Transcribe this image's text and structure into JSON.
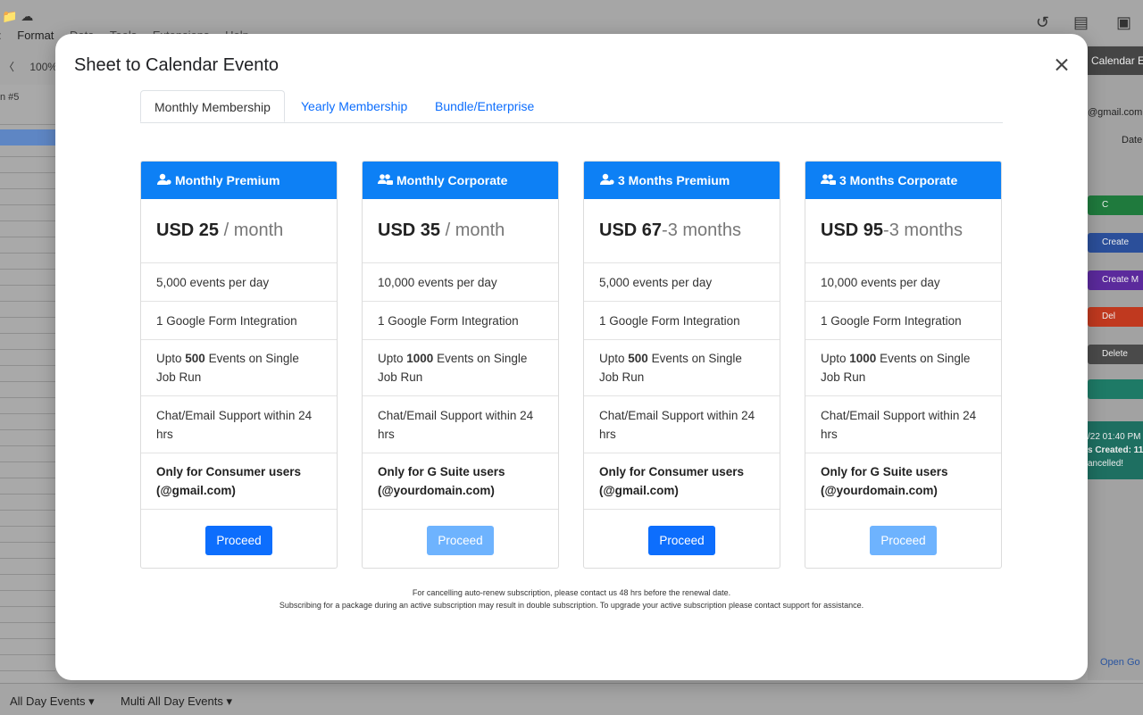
{
  "background": {
    "menu": [
      "Format",
      "Data",
      "Tools",
      "Extensions",
      "Help"
    ],
    "zoom": "100%",
    "name_box": "n #5",
    "sidebar": {
      "title": "Calendar Ev",
      "email": "@gmail.com",
      "date_label": "Date",
      "buttons": [
        {
          "label": "C",
          "color": "#1f7a3d"
        },
        {
          "label": "Create",
          "color": "#2b4f9a"
        },
        {
          "label": "Create M",
          "color": "#5b2a9c"
        },
        {
          "label": "Del",
          "color": "#c0391f"
        },
        {
          "label": "Delete",
          "color": "#4a4a4a"
        },
        {
          "label": "",
          "color": "#1e7a66"
        }
      ],
      "info_lines": [
        "/22 01:40 PM",
        "s Created: 11",
        "ancelled!"
      ],
      "link": "Open Go"
    },
    "sheet_tabs": [
      "All Day Events",
      "Multi All Day Events"
    ]
  },
  "modal": {
    "title": "Sheet to Calendar Evento",
    "tabs": [
      {
        "label": "Monthly Membership",
        "active": true
      },
      {
        "label": "Yearly Membership",
        "active": false
      },
      {
        "label": "Bundle/Enterprise",
        "active": false
      }
    ],
    "plans": [
      {
        "name": "Monthly Premium",
        "icon": "user-icon",
        "amount": "USD 25",
        "period": " / month",
        "events_per_day": "5,000 events per day",
        "integration": "1 Google Form Integration",
        "run_pre": "Upto ",
        "run_num": "500",
        "run_post": " Events on Single Job Run",
        "support": "Chat/Email Support within 24 hrs",
        "audience": "Only for Consumer users (@gmail.com)",
        "button": "Proceed",
        "button_style": "primary"
      },
      {
        "name": "Monthly Corporate",
        "icon": "users-icon",
        "amount": "USD 35",
        "period": " / month",
        "events_per_day": "10,000 events per day",
        "integration": "1 Google Form Integration",
        "run_pre": "Upto ",
        "run_num": "1000",
        "run_post": " Events on Single Job Run",
        "support": "Chat/Email Support within 24 hrs",
        "audience": "Only for G Suite users (@yourdomain.com)",
        "button": "Proceed",
        "button_style": "light"
      },
      {
        "name": "3 Months Premium",
        "icon": "user-icon",
        "amount": "USD 67",
        "period": "-3 months",
        "events_per_day": "5,000 events per day",
        "integration": "1 Google Form Integration",
        "run_pre": "Upto ",
        "run_num": "500",
        "run_post": " Events on Single Job Run",
        "support": "Chat/Email Support within 24 hrs",
        "audience": "Only for Consumer users (@gmail.com)",
        "button": "Proceed",
        "button_style": "primary"
      },
      {
        "name": "3 Months Corporate",
        "icon": "users-icon",
        "amount": "USD 95",
        "period": "-3 months",
        "events_per_day": "10,000 events per day",
        "integration": "1 Google Form Integration",
        "run_pre": "Upto ",
        "run_num": "1000",
        "run_post": " Events on Single Job Run",
        "support": "Chat/Email Support within 24 hrs",
        "audience": "Only for G Suite users (@yourdomain.com)",
        "button": "Proceed",
        "button_style": "light"
      }
    ],
    "notes": [
      "For cancelling auto-renew subscription, please contact us 48 hrs before the renewal date.",
      "Subscribing for a package during an active subscription may result in double subscription. To upgrade your active subscription please contact support for assistance."
    ]
  },
  "colors": {
    "primary": "#0d6efd",
    "header_blue": "#0d80f5",
    "primary_light": "#6eb3fe"
  }
}
